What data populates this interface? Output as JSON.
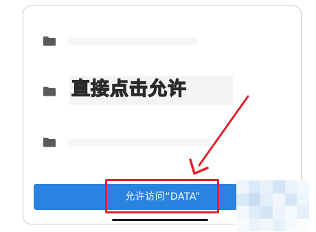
{
  "annotation": {
    "text": "直接点击允许"
  },
  "folders": [
    {
      "icon": "folder-icon"
    },
    {
      "icon": "folder-icon"
    },
    {
      "icon": "folder-icon"
    }
  ],
  "allow_button": {
    "label": "允许访问“DATA”"
  },
  "colors": {
    "button_blue": "#2a83e0",
    "highlight_red": "#e0222c",
    "annotation_yellow": "#f3d21a"
  }
}
